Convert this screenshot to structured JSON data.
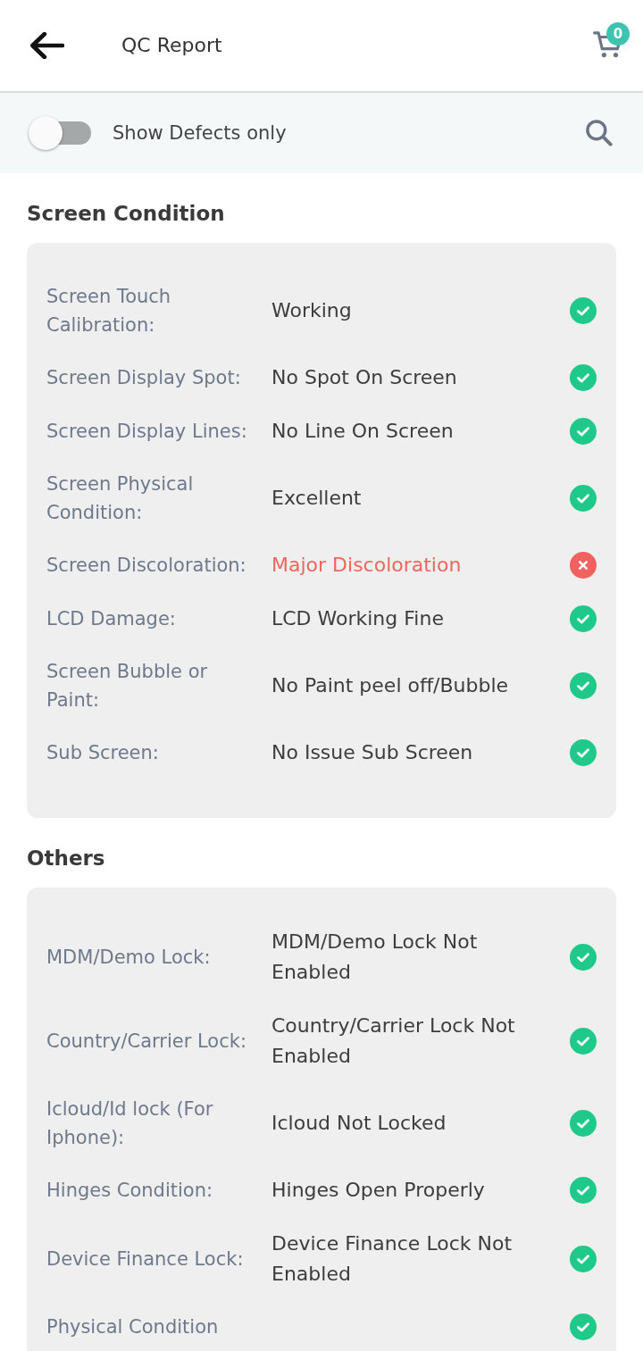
{
  "header": {
    "title": "QC Report",
    "cart_count": "0"
  },
  "filter": {
    "label": "Show Defects only",
    "on": false
  },
  "sections": [
    {
      "title": "Screen Condition",
      "items": [
        {
          "label": "Screen Touch Calibration:",
          "value": "Working",
          "defect": false
        },
        {
          "label": "Screen Display Spot:",
          "value": "No Spot On Screen",
          "defect": false
        },
        {
          "label": "Screen Display Lines:",
          "value": "No Line On Screen",
          "defect": false
        },
        {
          "label": "Screen Physical Condition:",
          "value": "Excellent",
          "defect": false
        },
        {
          "label": "Screen Discoloration:",
          "value": "Major Discoloration",
          "defect": true
        },
        {
          "label": "LCD Damage:",
          "value": "LCD Working Fine",
          "defect": false
        },
        {
          "label": "Screen Bubble or Paint:",
          "value": "No Paint peel off/Bubble",
          "defect": false
        },
        {
          "label": "Sub Screen:",
          "value": "No Issue Sub Screen",
          "defect": false
        }
      ]
    },
    {
      "title": "Others",
      "items": [
        {
          "label": "MDM/Demo Lock:",
          "value": "MDM/Demo Lock Not Enabled",
          "defect": false
        },
        {
          "label": "Country/Carrier Lock:",
          "value": "Country/Carrier Lock Not Enabled",
          "defect": false
        },
        {
          "label": "Icloud/Id lock (For Iphone):",
          "value": "Icloud Not Locked",
          "defect": false
        },
        {
          "label": "Hinges Condition:",
          "value": "Hinges Open Properly",
          "defect": false
        },
        {
          "label": "Device Finance Lock:",
          "value": "Device Finance Lock Not Enabled",
          "defect": false
        },
        {
          "label": "Physical Condition",
          "defect": false
        }
      ]
    }
  ]
}
